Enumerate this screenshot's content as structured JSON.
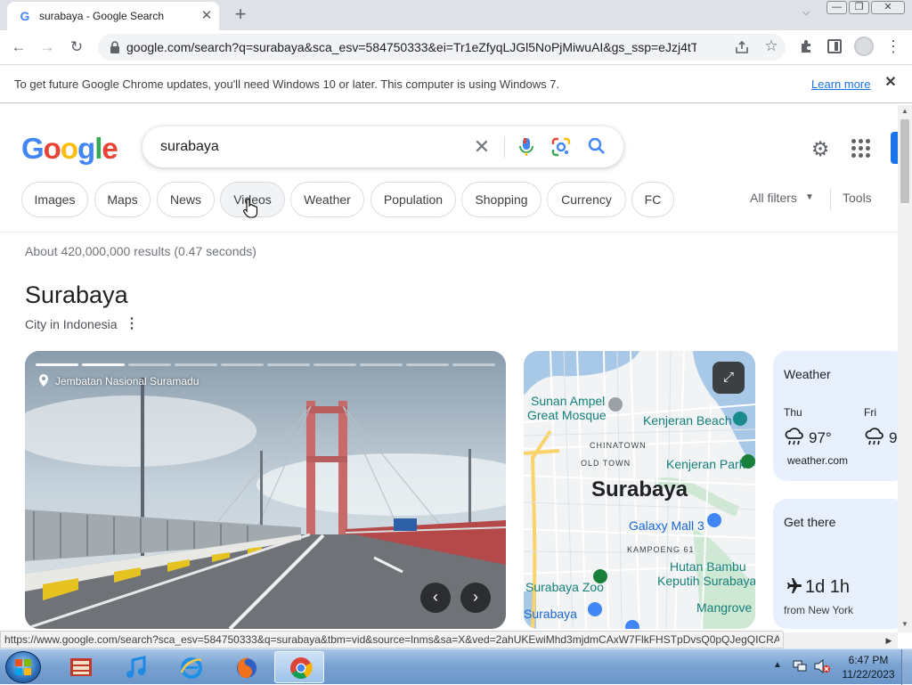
{
  "browser": {
    "tab_title": "surabaya - Google Search",
    "tab_favicon": "G",
    "url": "google.com/search?q=surabaya&sca_esv=584750333&ei=Tr1eZfyqLJGl5NoPjMiwuAI&gs_ssp=eJzj4tTP1Tc...",
    "icons": [
      "tab-search-icon",
      "minimize-icon",
      "maximize-icon",
      "close-icon",
      "back-icon",
      "forward-icon",
      "reload-icon",
      "lock-icon",
      "share-icon",
      "bookmark-star-icon",
      "extensions-icon",
      "side-panel-icon",
      "profile-avatar",
      "menu-icon"
    ]
  },
  "infobar": {
    "message": "To get future Google Chrome updates, you'll need Windows 10 or later. This computer is using Windows 7.",
    "learn_more": "Learn more"
  },
  "search": {
    "logo_letters": [
      "G",
      "o",
      "o",
      "g",
      "l",
      "e"
    ],
    "query": "surabaya",
    "chips": [
      {
        "label": "Images"
      },
      {
        "label": "Maps"
      },
      {
        "label": "News"
      },
      {
        "label": "Videos"
      },
      {
        "label": "Weather"
      },
      {
        "label": "Population"
      },
      {
        "label": "Shopping"
      },
      {
        "label": "Currency"
      },
      {
        "label": "FC"
      }
    ],
    "all_filters": "All filters",
    "tools": "Tools",
    "result_stats": "About 420,000,000 results (0.47 seconds)"
  },
  "knowledge_panel": {
    "title": "Surabaya",
    "subtitle": "City in Indonesia",
    "photo_caption": "Jembatan Nasional Suramadu",
    "photo_segments": 10,
    "photo_segments_viewed": 2,
    "map": {
      "city": "Surabaya",
      "places": [
        {
          "name": "Sunan Ampel",
          "kind": "place"
        },
        {
          "name": "Great Mosque",
          "kind": "place"
        },
        {
          "name": "Kenjeran Beach",
          "kind": "place"
        },
        {
          "name": "CHINATOWN",
          "kind": "district"
        },
        {
          "name": "OLD TOWN",
          "kind": "district"
        },
        {
          "name": "Kenjeran Park",
          "kind": "place"
        },
        {
          "name": "Galaxy Mall 3",
          "kind": "shop"
        },
        {
          "name": "KAMPOENG 61",
          "kind": "district"
        },
        {
          "name": "Hutan Bambu",
          "kind": "place"
        },
        {
          "name": "Keputih Surabaya",
          "kind": "place"
        },
        {
          "name": "Surabaya Zoo",
          "kind": "place"
        },
        {
          "name": "Mangrove",
          "kind": "place"
        },
        {
          "name": "Surabaya",
          "kind": "shop"
        }
      ]
    },
    "weather": {
      "title": "Weather",
      "days": [
        {
          "day": "Thu",
          "temp": "97°",
          "icon": "rain-cloud-icon"
        },
        {
          "day": "Fri",
          "temp": "9",
          "icon": "rain-cloud-icon"
        }
      ],
      "source": "weather.com"
    },
    "get_there": {
      "title": "Get there",
      "time": "1d 1h",
      "from": "from New York"
    }
  },
  "status_url": "https://www.google.com/search?sca_esv=584750333&q=surabaya&tbm=vid&source=lnms&sa=X&ved=2ahUKEwiMhd3mjdmCAxW7FlkFHSTpDvsQ0pQJegQICRAB",
  "taskbar": {
    "apps": [
      "file-manager-app",
      "itunes-app",
      "internet-explorer-app",
      "firefox-app",
      "chrome-app"
    ],
    "time": "6:47 PM",
    "date": "11/22/2023"
  },
  "colors": {
    "google_blue": "#4285f4",
    "google_red": "#ea4335",
    "google_yellow": "#fbbc05",
    "google_green": "#34a853",
    "link_blue": "#1a73e8",
    "card_bg": "#e8f0fe"
  }
}
